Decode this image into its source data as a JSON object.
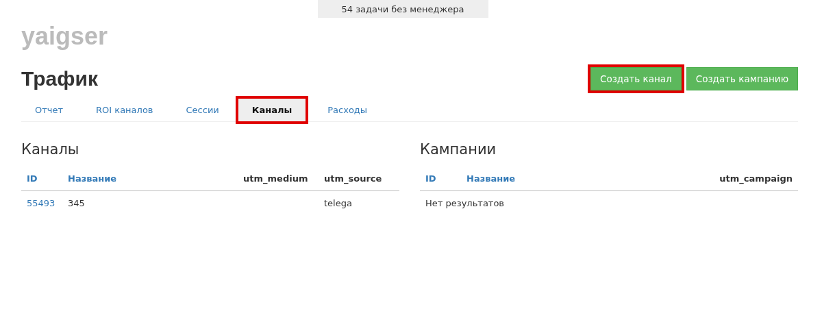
{
  "banner": "54 задачи без менеджера",
  "logo": "yaigser",
  "title": "Трафик",
  "buttons": [
    {
      "label": "Создать канал",
      "highlighted": true
    },
    {
      "label": "Создать кампанию",
      "highlighted": false
    }
  ],
  "tabs": [
    {
      "label": "Отчет",
      "selected": false,
      "highlighted": false
    },
    {
      "label": "ROI каналов",
      "selected": false,
      "highlighted": false
    },
    {
      "label": "Сессии",
      "selected": false,
      "highlighted": false
    },
    {
      "label": "Каналы",
      "selected": true,
      "highlighted": true
    },
    {
      "label": "Расходы",
      "selected": false,
      "highlighted": false
    }
  ],
  "sections": [
    {
      "title": "Каналы",
      "columns": [
        {
          "label": "ID",
          "kind": "link"
        },
        {
          "label": "Название",
          "kind": "link"
        },
        {
          "label": "utm_medium",
          "kind": "plain"
        },
        {
          "label": "utm_source",
          "kind": "plain"
        }
      ],
      "rows": [
        [
          "55493",
          "345",
          "",
          "telega"
        ]
      ]
    },
    {
      "title": "Кампании",
      "columns": [
        {
          "label": "ID",
          "kind": "link"
        },
        {
          "label": "Название",
          "kind": "link"
        },
        {
          "label": "utm_campaign",
          "kind": "plain"
        }
      ],
      "empty": "Нет результатов"
    }
  ]
}
